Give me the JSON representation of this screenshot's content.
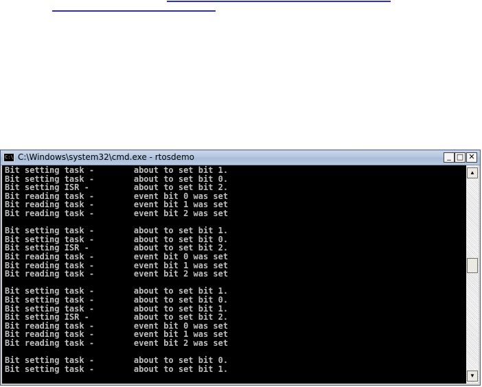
{
  "window": {
    "title": "C:\\Windows\\system32\\cmd.exe - rtosdemo",
    "app_icon": "cmd-prompt-icon",
    "app_icon_glyph": "C:\\",
    "controls": {
      "minimize_glyph": "_",
      "maximize_glyph": "□",
      "close_glyph": "✕"
    }
  },
  "console": {
    "text_color": "#c0c0c0",
    "background": "#000000",
    "lines": [
      "Bit setting task -        about to set bit 1.",
      "Bit setting task -        about to set bit 0.",
      "Bit setting ISR -         about to set bit 2.",
      "Bit reading task -        event bit 0 was set",
      "Bit reading task -        event bit 1 was set",
      "Bit reading task -        event bit 2 was set",
      "",
      "Bit setting task -        about to set bit 1.",
      "Bit setting task -        about to set bit 0.",
      "Bit setting ISR -         about to set bit 2.",
      "Bit reading task -        event bit 0 was set",
      "Bit reading task -        event bit 1 was set",
      "Bit reading task -        event bit 2 was set",
      "",
      "Bit setting task -        about to set bit 1.",
      "Bit setting task -        about to set bit 0.",
      "Bit setting task -        about to set bit 1.",
      "Bit setting ISR -         about to set bit 2.",
      "Bit reading task -        event bit 0 was set",
      "Bit reading task -        event bit 1 was set",
      "Bit reading task -        event bit 2 was set",
      "",
      "Bit setting task -        about to set bit 0.",
      "Bit setting task -        about to set bit 1."
    ]
  },
  "scrollbar": {
    "up_glyph": "▲",
    "down_glyph": "▼",
    "position_fraction": 0.45
  },
  "colors": {
    "link": "#2b2bd8",
    "titlebar": "#b5c7e0"
  }
}
